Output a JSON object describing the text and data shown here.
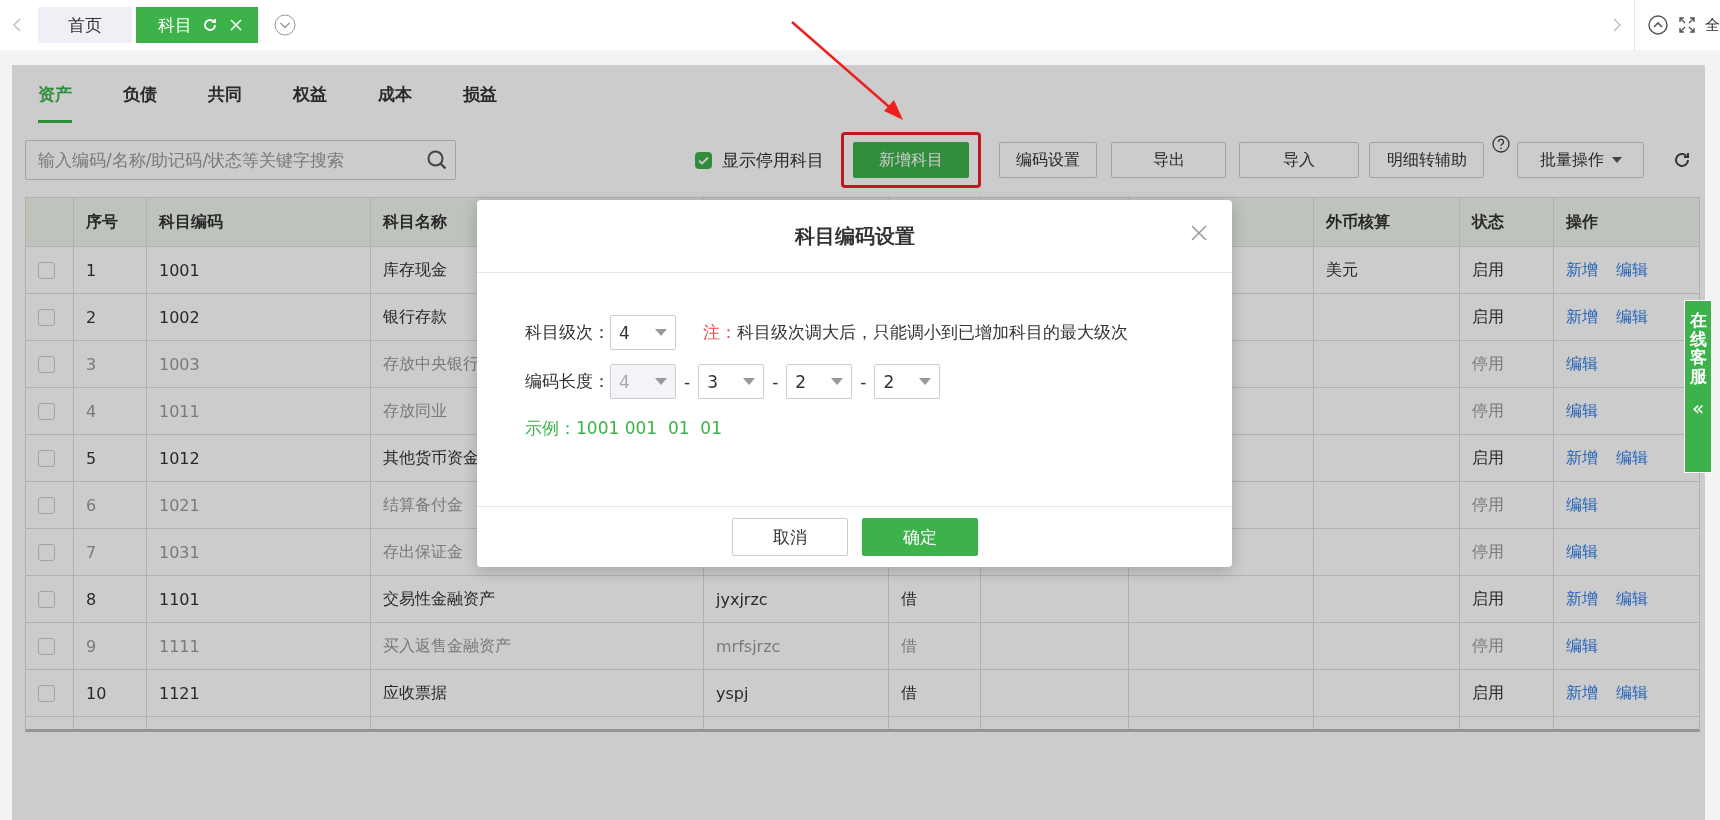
{
  "tab_bar": {
    "tabs": [
      {
        "label": "首页",
        "selected": false,
        "closable": false
      },
      {
        "label": "科目",
        "selected": true,
        "closable": true
      }
    ],
    "fullscreen_label": "全"
  },
  "category_tabs": [
    {
      "label": "资产",
      "selected": true
    },
    {
      "label": "负债",
      "selected": false
    },
    {
      "label": "共同",
      "selected": false
    },
    {
      "label": "权益",
      "selected": false
    },
    {
      "label": "成本",
      "selected": false
    },
    {
      "label": "损益",
      "selected": false
    }
  ],
  "toolbar": {
    "search": {
      "placeholder": "输入编码/名称/助记码/状态等关键字搜索"
    },
    "show_disabled": {
      "label": "显示停用科目",
      "checked": true
    },
    "buttons": [
      {
        "label": "新增科目",
        "kind": "primary",
        "highlighted": true
      },
      {
        "label": "编码设置",
        "kind": "default",
        "highlighted": false
      },
      {
        "label": "导出",
        "kind": "default",
        "highlighted": false
      },
      {
        "label": "导入",
        "kind": "default",
        "highlighted": false
      },
      {
        "label": "明细转辅助",
        "kind": "help",
        "highlighted": false
      },
      {
        "label": "批量操作",
        "kind": "dropdown",
        "highlighted": false
      }
    ]
  },
  "table": {
    "columns": [
      {
        "label": "序号"
      },
      {
        "label": "科目编码"
      },
      {
        "label": "科目名称"
      },
      {},
      {},
      {},
      {},
      {
        "label": "外币核算"
      },
      {
        "label": "状态"
      },
      {
        "label": "操作"
      }
    ],
    "rows": [
      {
        "no": "1",
        "code": "1001",
        "name": "库存现金",
        "currency": "美元",
        "status": "启用",
        "enabled": true,
        "actions": [
          "新增",
          "编辑"
        ]
      },
      {
        "no": "2",
        "code": "1002",
        "name": "银行存款",
        "status": "启用",
        "enabled": true,
        "actions": [
          "新增",
          "编辑"
        ]
      },
      {
        "no": "3",
        "code": "1003",
        "name": "存放中央银行",
        "status": "停用",
        "enabled": false,
        "actions": [
          "编辑"
        ]
      },
      {
        "no": "4",
        "code": "1011",
        "name": "存放同业",
        "status": "停用",
        "enabled": false,
        "actions": [
          "编辑"
        ]
      },
      {
        "no": "5",
        "code": "1012",
        "name": "其他货币资金",
        "status": "启用",
        "enabled": true,
        "actions": [
          "新增",
          "编辑"
        ]
      },
      {
        "no": "6",
        "code": "1021",
        "name": "结算备付金",
        "status": "停用",
        "enabled": false,
        "actions": [
          "编辑"
        ]
      },
      {
        "no": "7",
        "code": "1031",
        "name": "存出保证金",
        "status": "停用",
        "enabled": false,
        "actions": [
          "编辑"
        ]
      },
      {
        "no": "8",
        "code": "1101",
        "name": "交易性金融资产",
        "mnemonic": "jyxjrzc",
        "direction": "借",
        "status": "启用",
        "enabled": true,
        "actions": [
          "新增",
          "编辑"
        ]
      },
      {
        "no": "9",
        "code": "1111",
        "name": "买入返售金融资产",
        "mnemonic": "mrfsjrzc",
        "direction": "借",
        "status": "停用",
        "enabled": false,
        "actions": [
          "编辑"
        ]
      },
      {
        "no": "10",
        "code": "1121",
        "name": "应收票据",
        "mnemonic": "yspj",
        "direction": "借",
        "status": "启用",
        "enabled": true,
        "actions": [
          "新增",
          "编辑"
        ]
      }
    ]
  },
  "dialog": {
    "title": "科目编码设置",
    "level": {
      "label": "科目级次：",
      "value": "4"
    },
    "note_label": "注：",
    "note": "科目级次调大后，只能调小到已增加科目的最大级次",
    "lengths": {
      "label": "编码长度：",
      "selects": [
        {
          "value": "4",
          "disabled": true
        },
        {
          "value": "3",
          "disabled": false,
          "separator": "-"
        },
        {
          "value": "2",
          "disabled": false,
          "separator": "-"
        },
        {
          "value": "2",
          "disabled": false,
          "separator": "-"
        }
      ]
    },
    "example": "示例：1001 001  01  01",
    "buttons": [
      {
        "label": "取消",
        "kind": "default"
      },
      {
        "label": "确定",
        "kind": "primary"
      }
    ]
  },
  "service_tab": {
    "label": "在线客服",
    "arrow": "«"
  }
}
